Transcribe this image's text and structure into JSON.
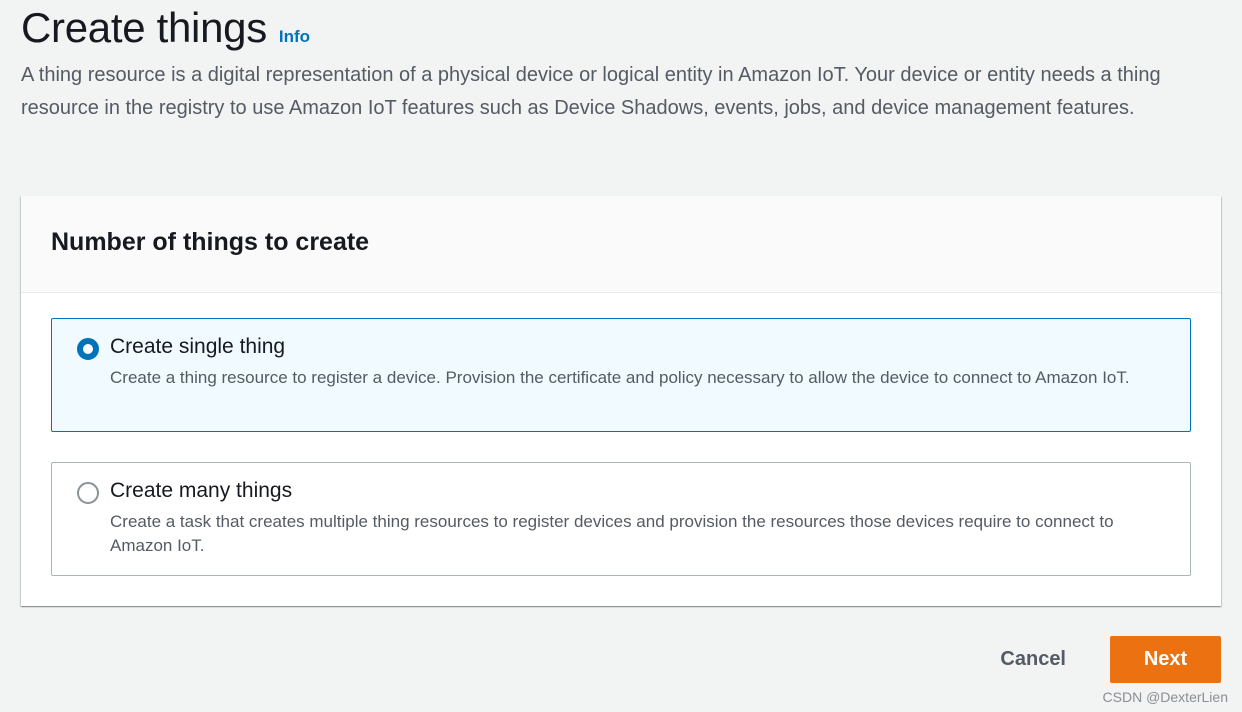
{
  "header": {
    "title": "Create things",
    "info_link": "Info",
    "description": "A thing resource is a digital representation of a physical device or logical entity in Amazon IoT. Your device or entity needs a thing resource in the registry to use Amazon IoT features such as Device Shadows, events, jobs, and device management features."
  },
  "container": {
    "title": "Number of things to create",
    "options": [
      {
        "label": "Create single thing",
        "description": "Create a thing resource to register a device. Provision the certificate and policy necessary to allow the device to connect to Amazon IoT.",
        "selected": true
      },
      {
        "label": "Create many things",
        "description": "Create a task that creates multiple thing resources to register devices and provision the resources those devices require to connect to Amazon IoT.",
        "selected": false
      }
    ]
  },
  "actions": {
    "cancel_label": "Cancel",
    "next_label": "Next"
  },
  "watermark": "CSDN @DexterLien",
  "colors": {
    "accent": "#0073bb",
    "primary_button": "#ec7211",
    "background": "#f2f3f3"
  }
}
